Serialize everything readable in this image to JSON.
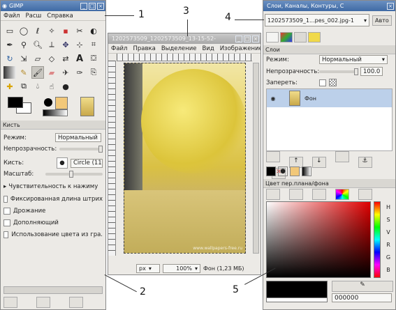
{
  "toolbox": {
    "title": "GIMP",
    "menu": [
      "Файл",
      "Расш",
      "Справка"
    ],
    "brush_panel_title": "Кисть",
    "mode_label": "Режим:",
    "mode_value": "Нормальный",
    "opacity_label": "Непрозрачность:",
    "brush_label": "Кисть:",
    "brush_value": "Circle (11",
    "scale_label": "Масштаб:",
    "sensitivity_label": "Чувствительность к нажиму",
    "options": [
      "Фиксированная длина штрих",
      "Дрожание",
      "Дополняющий",
      "Использование цвета из гра."
    ]
  },
  "image_window": {
    "title": "1202573509_1202573509_13-15-52-",
    "menu": [
      "Файл",
      "Правка",
      "Выделение",
      "Вид",
      "Изображение"
    ],
    "unit": "px",
    "zoom": "100%",
    "status": "Фон (1,23 МБ)",
    "photo_watermark": "www.wallpapers-free.ru"
  },
  "dock": {
    "title": "Слои, Каналы, Контуры, С",
    "image_selector": "1202573509_1...pes_002.jpg-1",
    "auto_label": "Авто",
    "layers_header": "Слои",
    "mode_label": "Режим:",
    "mode_value": "Нормальный",
    "opacity_label": "Непрозрачность:",
    "opacity_value": "100.0",
    "lock_label": "Запереть:",
    "layer_name": "Фон",
    "fg_bg_header": "Цвет пер.плана/фона",
    "palette_letters": [
      "Н",
      "S",
      "V",
      "R",
      "G",
      "B"
    ],
    "hex_value": "000000"
  },
  "callouts": [
    "1",
    "2",
    "3",
    "4",
    "5"
  ],
  "colors": {
    "titlebar": "#3f6aa5",
    "panel": "#eceae6",
    "selection": "#bcd0ea",
    "foreground": "#000000",
    "background_swatch": "#f2c879"
  }
}
